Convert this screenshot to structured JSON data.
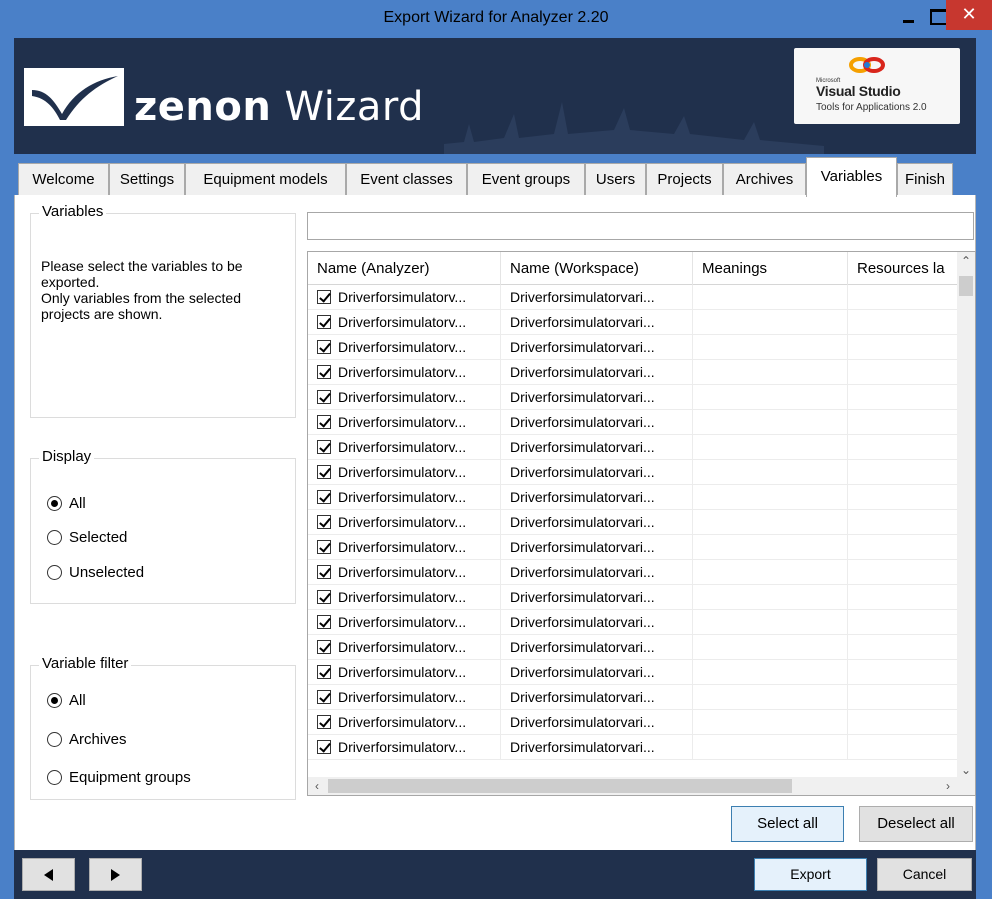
{
  "window": {
    "title": "Export Wizard for Analyzer 2.20",
    "close_glyph": "✕"
  },
  "banner": {
    "brand_bold": "zenon",
    "brand_light": " Wizard",
    "vs_small": "Microsoft",
    "vs_name": "Visual Studio",
    "vs_sub": "Tools for Applications 2.0",
    "logo_icon": "zenon-swoosh-icon"
  },
  "tabs": [
    {
      "label": "Welcome",
      "active": false
    },
    {
      "label": "Settings",
      "active": false
    },
    {
      "label": "Equipment models",
      "active": false
    },
    {
      "label": "Event classes",
      "active": false
    },
    {
      "label": "Event groups",
      "active": false
    },
    {
      "label": "Users",
      "active": false
    },
    {
      "label": "Projects",
      "active": false
    },
    {
      "label": "Archives",
      "active": false
    },
    {
      "label": "Variables",
      "active": true
    },
    {
      "label": "Finish",
      "active": false
    }
  ],
  "variables_group": {
    "legend": "Variables",
    "description": "Please select the variables to be exported.\nOnly variables from the selected projects are shown."
  },
  "display_group": {
    "legend": "Display",
    "options": [
      {
        "label": "All",
        "checked": true
      },
      {
        "label": "Selected",
        "checked": false
      },
      {
        "label": "Unselected",
        "checked": false
      }
    ]
  },
  "filter_group": {
    "legend": "Variable filter",
    "options": [
      {
        "label": "All",
        "checked": true
      },
      {
        "label": "Archives",
        "checked": false
      },
      {
        "label": "Equipment groups",
        "checked": false
      }
    ]
  },
  "search": {
    "value": "",
    "placeholder": ""
  },
  "grid": {
    "columns": [
      "Name (Analyzer)",
      "Name (Workspace)",
      "Meanings",
      "Resources la"
    ],
    "rows": [
      {
        "checked": true,
        "name_analyzer": "Driverforsimulatorv...",
        "name_workspace": "Driverforsimulatorvari...",
        "meanings": "",
        "resources": ""
      },
      {
        "checked": true,
        "name_analyzer": "Driverforsimulatorv...",
        "name_workspace": "Driverforsimulatorvari...",
        "meanings": "",
        "resources": ""
      },
      {
        "checked": true,
        "name_analyzer": "Driverforsimulatorv...",
        "name_workspace": "Driverforsimulatorvari...",
        "meanings": "",
        "resources": ""
      },
      {
        "checked": true,
        "name_analyzer": "Driverforsimulatorv...",
        "name_workspace": "Driverforsimulatorvari...",
        "meanings": "",
        "resources": ""
      },
      {
        "checked": true,
        "name_analyzer": "Driverforsimulatorv...",
        "name_workspace": "Driverforsimulatorvari...",
        "meanings": "",
        "resources": ""
      },
      {
        "checked": true,
        "name_analyzer": "Driverforsimulatorv...",
        "name_workspace": "Driverforsimulatorvari...",
        "meanings": "",
        "resources": ""
      },
      {
        "checked": true,
        "name_analyzer": "Driverforsimulatorv...",
        "name_workspace": "Driverforsimulatorvari...",
        "meanings": "",
        "resources": ""
      },
      {
        "checked": true,
        "name_analyzer": "Driverforsimulatorv...",
        "name_workspace": "Driverforsimulatorvari...",
        "meanings": "",
        "resources": ""
      },
      {
        "checked": true,
        "name_analyzer": "Driverforsimulatorv...",
        "name_workspace": "Driverforsimulatorvari...",
        "meanings": "",
        "resources": ""
      },
      {
        "checked": true,
        "name_analyzer": "Driverforsimulatorv...",
        "name_workspace": "Driverforsimulatorvari...",
        "meanings": "",
        "resources": ""
      },
      {
        "checked": true,
        "name_analyzer": "Driverforsimulatorv...",
        "name_workspace": "Driverforsimulatorvari...",
        "meanings": "",
        "resources": ""
      },
      {
        "checked": true,
        "name_analyzer": "Driverforsimulatorv...",
        "name_workspace": "Driverforsimulatorvari...",
        "meanings": "",
        "resources": ""
      },
      {
        "checked": true,
        "name_analyzer": "Driverforsimulatorv...",
        "name_workspace": "Driverforsimulatorvari...",
        "meanings": "",
        "resources": ""
      },
      {
        "checked": true,
        "name_analyzer": "Driverforsimulatorv...",
        "name_workspace": "Driverforsimulatorvari...",
        "meanings": "",
        "resources": ""
      },
      {
        "checked": true,
        "name_analyzer": "Driverforsimulatorv...",
        "name_workspace": "Driverforsimulatorvari...",
        "meanings": "",
        "resources": ""
      },
      {
        "checked": true,
        "name_analyzer": "Driverforsimulatorv...",
        "name_workspace": "Driverforsimulatorvari...",
        "meanings": "",
        "resources": ""
      },
      {
        "checked": true,
        "name_analyzer": "Driverforsimulatorv...",
        "name_workspace": "Driverforsimulatorvari...",
        "meanings": "",
        "resources": ""
      },
      {
        "checked": true,
        "name_analyzer": "Driverforsimulatorv...",
        "name_workspace": "Driverforsimulatorvari...",
        "meanings": "",
        "resources": ""
      },
      {
        "checked": true,
        "name_analyzer": "Driverforsimulatorv...",
        "name_workspace": "Driverforsimulatorvari...",
        "meanings": "",
        "resources": ""
      }
    ]
  },
  "buttons": {
    "select_all": "Select all",
    "deselect_all": "Deselect all",
    "export": "Export",
    "cancel": "Cancel"
  },
  "colors": {
    "frame": "#4a80c8",
    "banner": "#20304c",
    "close": "#c7372f"
  }
}
